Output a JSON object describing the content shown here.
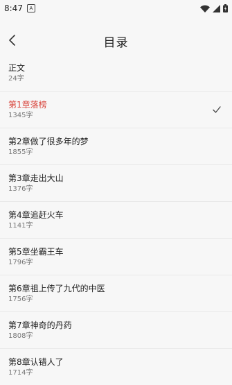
{
  "status": {
    "time": "8:47",
    "notif_glyph": "A"
  },
  "toolbar": {
    "title": "目录"
  },
  "chapters": [
    {
      "title": "正文",
      "count": "24字"
    },
    {
      "title": "第1章落榜",
      "count": "1345字"
    },
    {
      "title": "第2章做了很多年的梦",
      "count": "1855字"
    },
    {
      "title": "第3章走出大山",
      "count": "1376字"
    },
    {
      "title": "第4章追赶火车",
      "count": "1141字"
    },
    {
      "title": "第5章坐霸王车",
      "count": "1796字"
    },
    {
      "title": "第6章祖上传了九代的中医",
      "count": "1756字"
    },
    {
      "title": "第7章神奇的丹药",
      "count": "1808字"
    },
    {
      "title": "第8章认错人了",
      "count": "1714字"
    }
  ],
  "active_chapter": "第1章落榜",
  "colors": {
    "accent": "#d9453c",
    "background": "#f7f7f7"
  },
  "icons": [
    "wifi-icon",
    "signal-icon",
    "battery-icon",
    "back-arrow-icon",
    "check-icon"
  ]
}
